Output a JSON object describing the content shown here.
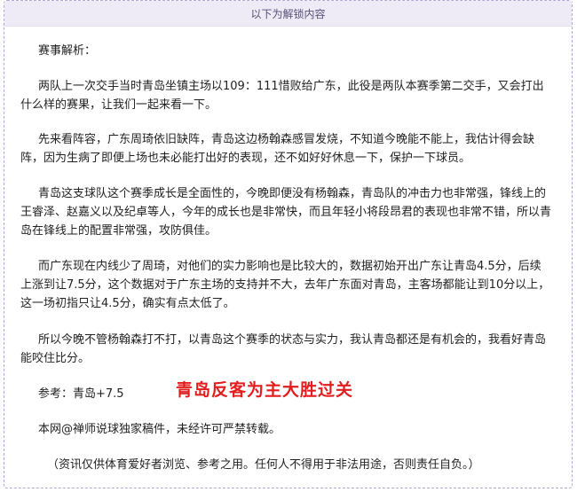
{
  "banner": {
    "text": "以下为解锁内容"
  },
  "article": {
    "section_title": "赛事解析：",
    "p1": [
      "两队上一次交手当时青岛坐镇主场以109：111惜败给广东，此役是两队本赛季第二交手，又会打出",
      "什么样的赛果，让我们一起来看一下。"
    ],
    "p2": [
      "先来看阵容，广东周琦依旧缺阵，青岛这边杨翰森感冒发烧，不知道今晚能不能上，我估计得会缺",
      "阵，因为生病了即便上场也未必能打出好的表现，还不如好好休息一下，保护一下球员。"
    ],
    "p3": [
      "青岛这支球队这个赛季成长是全面性的，今晚即便没有杨翰森，青岛队的冲击力也非常强，锋线上的",
      "王睿泽、赵嘉义以及纪卓等人，今年的成长也是非常快，而且年轻小将段昂君的表现也非常不错，所以青",
      "岛在锋线上的配置非常强，攻防俱佳。"
    ],
    "p4": [
      "而广东现在内线少了周琦，对他们的实力影响也是比较大的，数据初始开出广东让青岛4.5分，后续",
      "上涨到让7.5分，这个数据对于广东主场的支持并不大，去年广东面对青岛，主客场都能让到10分以上，",
      "这一场初指只让4.5分，确实有点太低了。"
    ],
    "p5": [
      "所以今晚不管杨翰森打不打，以青岛这个赛季的状态与实力，我认青岛都还是有机会的，我看好青岛",
      "能咬住比分。"
    ],
    "reference": "参考：青岛+7.5",
    "headline": "青岛反客为主大胜过关",
    "copyright": "本网@禅师说球独家稿件，未经许可严禁转载。",
    "disclaimer": "（资讯仅供体育爱好者浏览、参考之用。任何人不得用于非法用途，否则责任自负。）"
  }
}
